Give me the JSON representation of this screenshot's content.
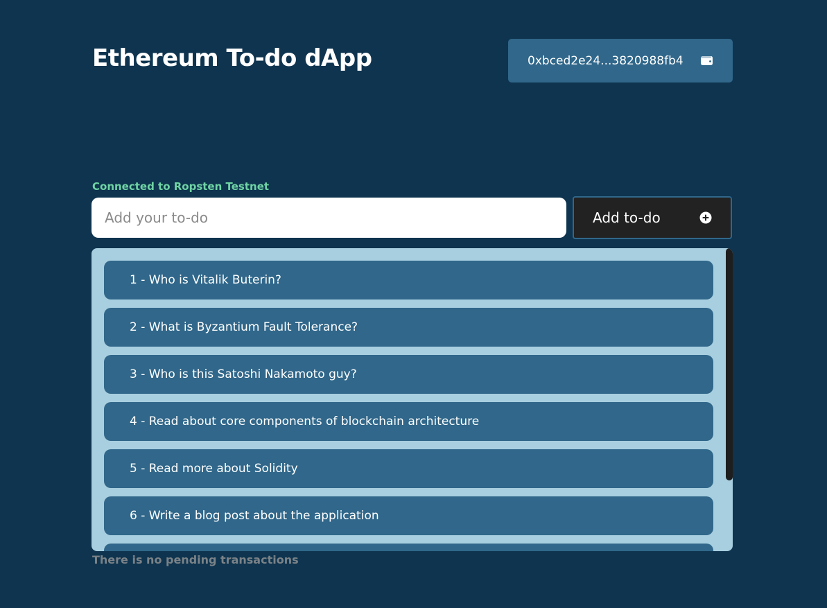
{
  "header": {
    "title": "Ethereum To-do dApp",
    "wallet_address": "0xbced2e24...3820988fb4",
    "wallet_icon": "wallet-icon"
  },
  "network": {
    "status_text": "Connected to Ropsten Testnet",
    "status_color": "#6fd3a3"
  },
  "form": {
    "input_placeholder": "Add your to-do",
    "input_value": "",
    "add_button_label": "Add to-do",
    "add_button_icon": "plus-circle-icon"
  },
  "todos": [
    {
      "label": "1 - Who is Vitalik Buterin?"
    },
    {
      "label": "2 - What is Byzantium Fault Tolerance?"
    },
    {
      "label": "3 - Who is this Satoshi Nakamoto guy?"
    },
    {
      "label": "4 - Read about core components of blockchain architecture"
    },
    {
      "label": "5 - Read more about Solidity"
    },
    {
      "label": "6 - Write a blog post about the application"
    },
    {
      "label": ""
    }
  ],
  "footer": {
    "pending_text": "There is no pending transactions"
  },
  "colors": {
    "background": "#0e344f",
    "accent": "#30678a",
    "panel": "#a8cfe0"
  }
}
